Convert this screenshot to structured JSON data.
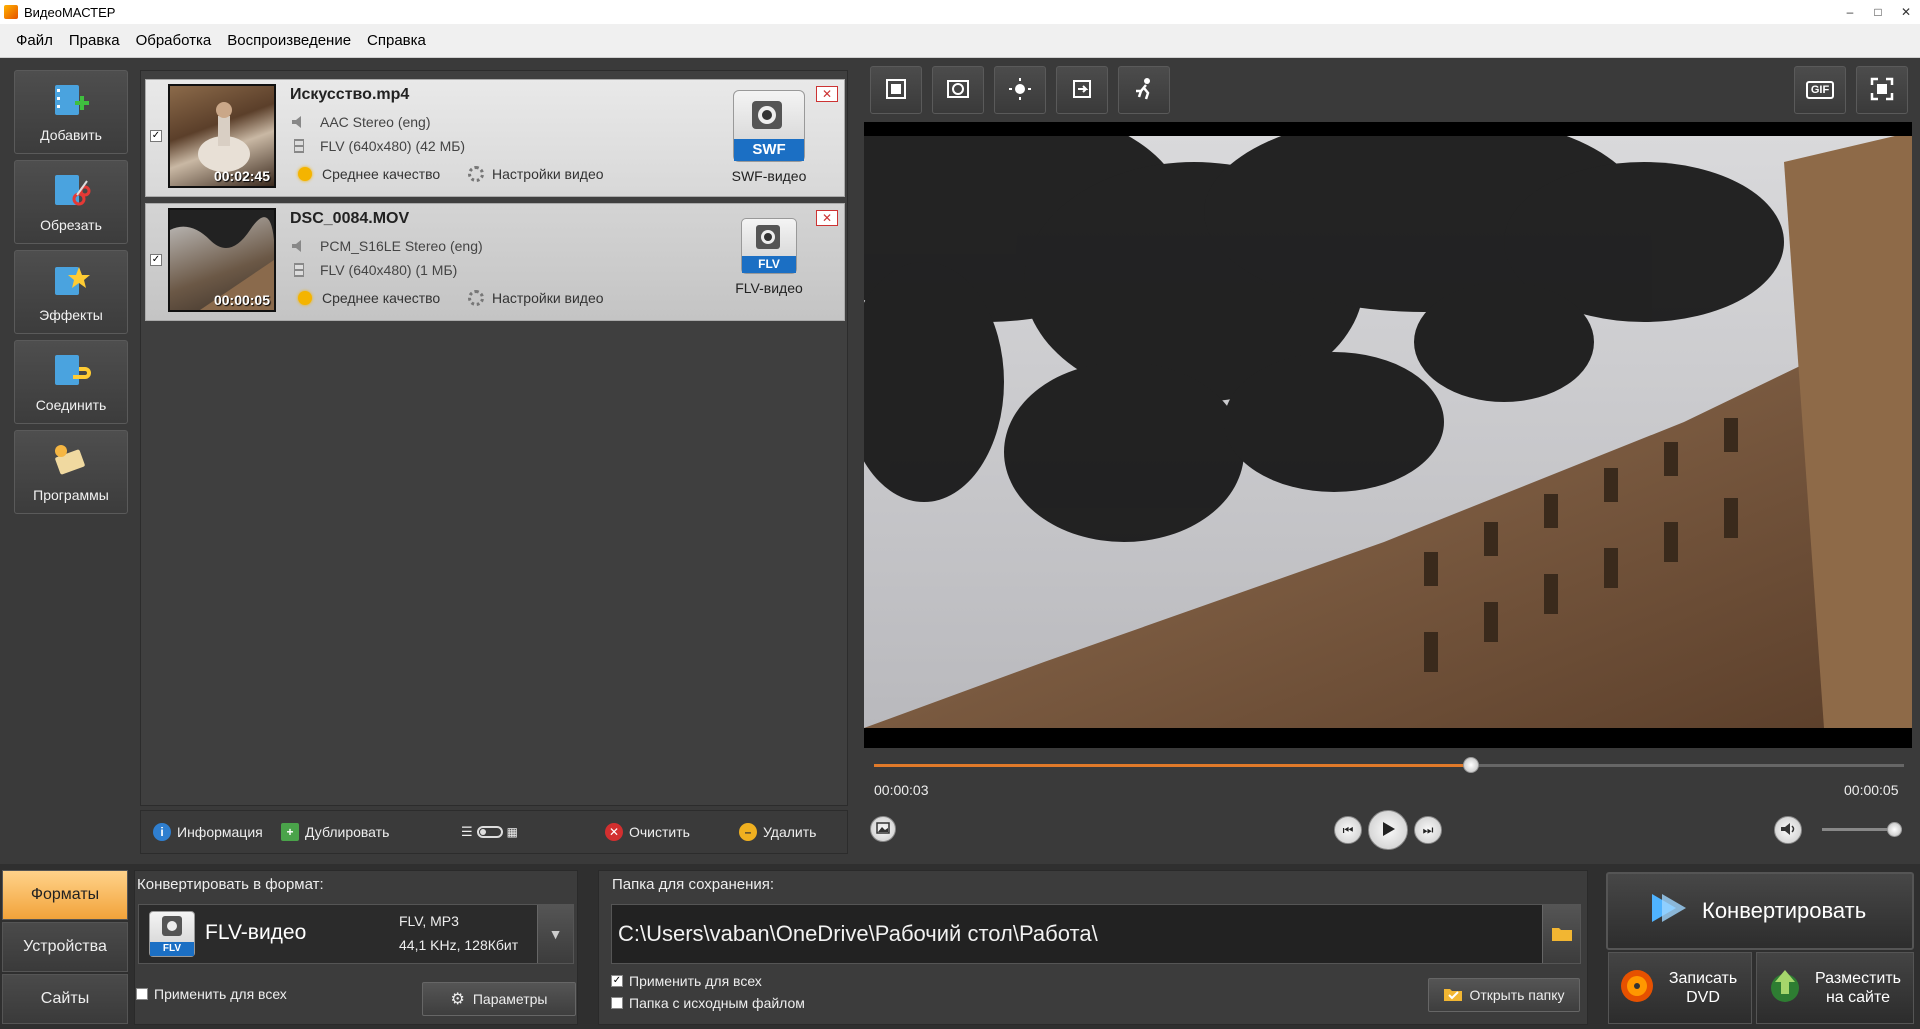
{
  "app": {
    "title": "ВидеоМАСТЕР",
    "window_controls": [
      "–",
      "□",
      "✕"
    ]
  },
  "menu": [
    "Файл",
    "Правка",
    "Обработка",
    "Воспроизведение",
    "Справка"
  ],
  "tools": [
    {
      "label": "Добавить",
      "icon": "add-film-icon"
    },
    {
      "label": "Обрезать",
      "icon": "scissors-film-icon"
    },
    {
      "label": "Эффекты",
      "icon": "magic-wand-icon"
    },
    {
      "label": "Соединить",
      "icon": "join-film-icon"
    },
    {
      "label": "Программы",
      "icon": "key-icon"
    }
  ],
  "files": [
    {
      "name": "Искусство.mp4",
      "duration": "00:02:45",
      "checked": true,
      "audio": "AAC Stereo (eng)",
      "video": "FLV (640x480) (42 МБ)",
      "quality": "Среднее качество",
      "settings": "Настройки видео",
      "format_badge": "SWF",
      "format_label": "SWF-видео"
    },
    {
      "name": "DSC_0084.MOV",
      "duration": "00:00:05",
      "checked": true,
      "audio": "PCM_S16LE Stereo (eng)",
      "video": "FLV (640x480) (1 МБ)",
      "quality": "Среднее качество",
      "settings": "Настройки видео",
      "format_badge": "FLV",
      "format_label": "FLV-видео"
    }
  ],
  "file_toolbar": {
    "info": "Информация",
    "duplicate": "Дублировать",
    "clear": "Очистить",
    "delete": "Удалить"
  },
  "preview": {
    "gif_label": "GIF",
    "current_time": "00:00:03",
    "total_time": "00:00:05",
    "progress": 0.58,
    "volume": 0.9
  },
  "bottom_tabs": [
    "Форматы",
    "Устройства",
    "Сайты"
  ],
  "convert": {
    "heading": "Конвертировать в формат:",
    "format_name": "FLV-видео",
    "format_badge": "FLV",
    "codec_line": "FLV, MP3",
    "audio_line": "44,1 KHz, 128Кбит",
    "apply_all": "Применить для всех",
    "params_button": "Параметры"
  },
  "save": {
    "heading": "Папка для сохранения:",
    "path": "C:\\Users\\vaban\\OneDrive\\Рабочий стол\\Работа\\",
    "apply_all": "Применить для всех",
    "apply_all_checked": true,
    "source_folder": "Папка с исходным файлом",
    "source_folder_checked": false,
    "open_folder": "Открыть папку"
  },
  "actions": {
    "convert": "Конвертировать",
    "burn_dvd_line1": "Записать",
    "burn_dvd_line2": "DVD",
    "publish_line1": "Разместить",
    "publish_line2": "на сайте"
  },
  "colors": {
    "accent_orange": "#e07a2a",
    "active_tab": "#f2a33a",
    "close_red": "#cc3333"
  }
}
